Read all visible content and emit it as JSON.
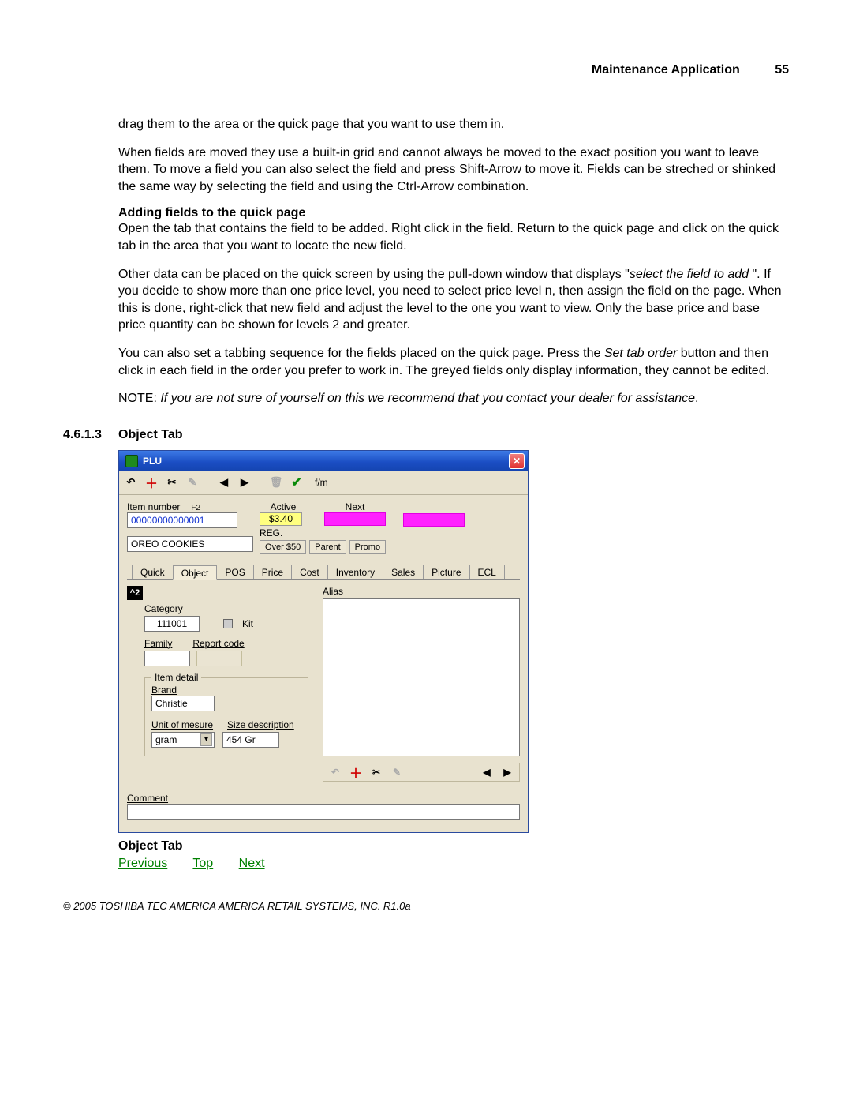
{
  "header": {
    "title": "Maintenance Application",
    "page": "55"
  },
  "para": {
    "p1": "drag them to the area or the quick page that you want to use them in.",
    "p2": " When fields are moved they use a built-in grid and cannot always be moved to the exact position you want to leave them. To move a field you can also select the field and press Shift-Arrow to move it. Fields can be streched or shinked the same way by selecting the field and using the Ctrl-Arrow combination.",
    "h1": "Adding fields to the quick page",
    "p3": " Open the tab that contains the field to be added. Right click in the field. Return to the quick page and click on the quick tab in the area that you want to locate the new field.",
    "p4a": " Other data can be placed on the quick screen by using the pull-down window that displays \"",
    "p4i": "select the field to add ",
    "p4b": "\". If you decide to show more than one price level, you need to select price level n, then assign the field on the page. When this is done, right-click that new field and adjust the level to the one you want to view. Only the base price and base price quantity can be shown for levels 2 and greater.",
    "p5a": " You can also set a tabbing sequence for the fields placed on the quick page. Press the ",
    "p5i": "Set tab order",
    "p5b": " button and then click in each field in the order you prefer to work in. The greyed fields only display information, they cannot be edited.",
    "p6a": "NOTE: ",
    "p6i": "If you are not sure of yourself on this we recommend that you contact your dealer for assistance",
    "p6b": "."
  },
  "section": {
    "num": "4.6.1.3",
    "title": "Object Tab"
  },
  "caption": "Object Tab",
  "nav": {
    "prev": "Previous",
    "top": "Top",
    "next": "Next"
  },
  "footer": "© 2005 TOSHIBA TEC AMERICA AMERICA RETAIL SYSTEMS, INC.   R1.0a",
  "plu": {
    "title": "PLU",
    "toolbar_fm": "f/m",
    "item_number_lbl": "Item number",
    "item_number_sup": "F2",
    "item_number_val": "00000000000001",
    "desc_val": "OREO COOKIES",
    "active_lbl": "Active",
    "next_lbl": "Next",
    "price": "$3.40",
    "reg": "REG.",
    "chips": [
      "Over $50",
      "Parent",
      "Promo"
    ],
    "tabs": [
      "Quick",
      "Object",
      "POS",
      "Price",
      "Cost",
      "Inventory",
      "Sales",
      "Picture",
      "ECL"
    ],
    "active_tab": 1,
    "tag": "^2",
    "category_lbl": "Category",
    "category_val": "111001",
    "kit_lbl": "Kit",
    "family_lbl": "Family",
    "report_lbl": "Report code",
    "item_detail_lbl": "Item detail",
    "brand_lbl": "Brand",
    "brand_val": "Christie",
    "uom_lbl": "Unit of mesure",
    "uom_val": "gram",
    "size_lbl": "Size description",
    "size_val": "454 Gr",
    "comment_lbl": "Comment",
    "alias_lbl": "Alias"
  }
}
